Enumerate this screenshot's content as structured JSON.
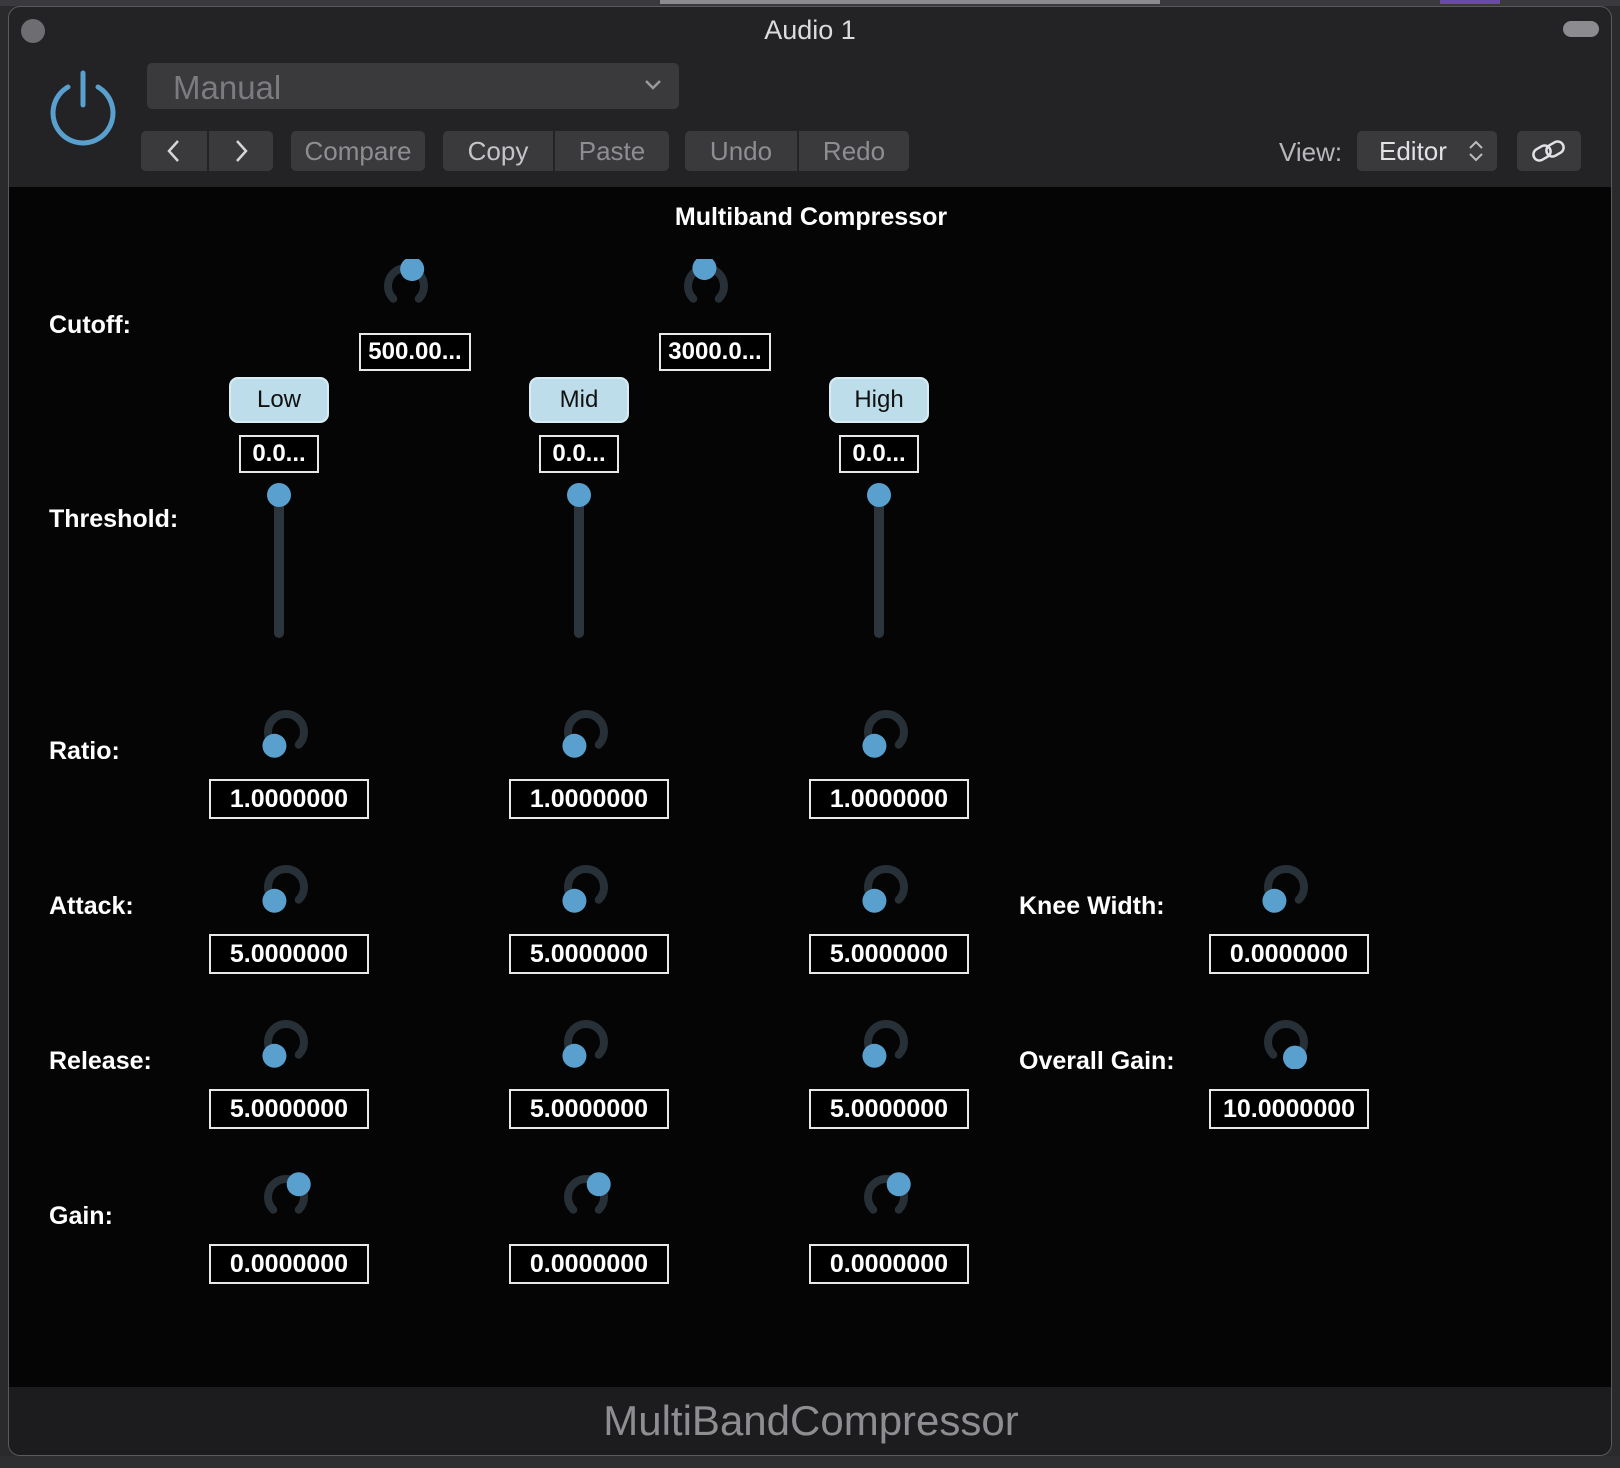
{
  "window": {
    "title": "Audio 1"
  },
  "toolbar": {
    "preset_value": "Manual",
    "prev_label": "<",
    "next_label": ">",
    "compare_label": "Compare",
    "copy_label": "Copy",
    "paste_label": "Paste",
    "undo_label": "Undo",
    "redo_label": "Redo",
    "view_label": "View:",
    "view_value": "Editor"
  },
  "plugin": {
    "title": "Multiband Compressor",
    "footer_name": "MultiBandCompressor",
    "accent_color": "#5aa0cf",
    "cutoff": {
      "label": "Cutoff:",
      "values": [
        "500.00...",
        "3000.0..."
      ]
    },
    "bands": [
      "Low",
      "Mid",
      "High"
    ],
    "threshold": {
      "label": "Threshold:",
      "values": [
        "0.0...",
        "0.0...",
        "0.0..."
      ]
    },
    "ratio": {
      "label": "Ratio:",
      "values": [
        "1.0000000",
        "1.0000000",
        "1.0000000"
      ]
    },
    "attack": {
      "label": "Attack:",
      "values": [
        "5.0000000",
        "5.0000000",
        "5.0000000"
      ]
    },
    "release": {
      "label": "Release:",
      "values": [
        "5.0000000",
        "5.0000000",
        "5.0000000"
      ]
    },
    "gain": {
      "label": "Gain:",
      "values": [
        "0.0000000",
        "0.0000000",
        "0.0000000"
      ]
    },
    "knee_width": {
      "label": "Knee Width:",
      "value": "0.0000000"
    },
    "overall_gain": {
      "label": "Overall Gain:",
      "value": "10.0000000"
    }
  }
}
